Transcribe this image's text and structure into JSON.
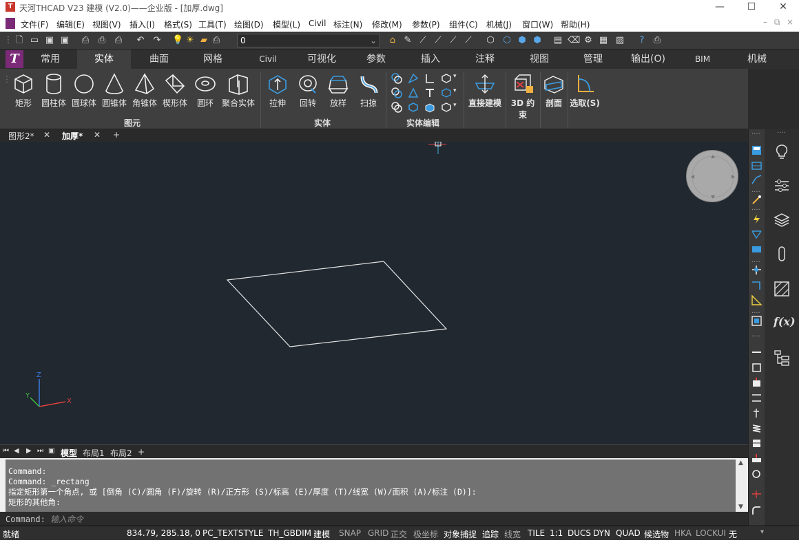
{
  "window": {
    "title": "天河THCAD V23 建模 (V2.0)——企业版 - [加厚.dwg]",
    "app_icon_letter": "T",
    "minimize": "—",
    "maximize": "☐",
    "close": "✕"
  },
  "menu": [
    "文件(F)",
    "编辑(E)",
    "视图(V)",
    "插入(I)",
    "格式(S)",
    "工具(T)",
    "绘图(D)",
    "模型(L)",
    "Civil",
    "标注(N)",
    "修改(M)",
    "参数(P)",
    "组件(C)",
    "机械(J)",
    "窗口(W)",
    "帮助(H)"
  ],
  "layer": {
    "current": "0"
  },
  "ribbon_tabs": [
    "常用",
    "实体",
    "曲面",
    "网格",
    "Civil",
    "可视化",
    "参数",
    "插入",
    "注释",
    "视图",
    "管理",
    "输出(O)",
    "BIM",
    "机械"
  ],
  "ribbon_active_tab": "实体",
  "ribbon": {
    "primitives": {
      "group": "图元",
      "buttons": [
        "矩形",
        "圆柱体",
        "圆球体",
        "圆锥体",
        "角锥体",
        "楔形体",
        "圆环",
        "聚合实体"
      ]
    },
    "solid": {
      "group": "实体",
      "buttons": [
        "拉伸",
        "回转",
        "放样",
        "扫掠"
      ]
    },
    "solid_edit": {
      "group": "实体编辑"
    },
    "direct": {
      "label": "直接建模"
    },
    "constraint": {
      "label": "3D 约束"
    },
    "section": {
      "label": "剖面"
    },
    "select": {
      "label": "选取(S)"
    }
  },
  "doc_tabs": [
    {
      "label": "图形2*"
    },
    {
      "label": "加厚*"
    }
  ],
  "doc_tab_add": "+",
  "layout_tabs": [
    "模型",
    "布局1",
    "布局2"
  ],
  "layout_add": "+",
  "ucs": {
    "x": "X",
    "y": "Y",
    "z": "Z"
  },
  "command_history": [
    "Command:",
    "Command: _rectang",
    "指定矩形第一个角点, 或 [倒角 (C)/圆角 (F)/旋转 (R)/正方形 (S)/标高 (E)/厚度 (T)/线宽 (W)/面积 (A)/标注 (D)]:",
    "矩形的其他角:"
  ],
  "command_prompt": "Command:",
  "command_placeholder": "输入命令",
  "status": {
    "ready": "就绪",
    "coords": "834.79, 285.18, 0",
    "textstyle": "PC_TEXTSTYLE",
    "dimstyle": "TH_GBDIM",
    "workspace": "建模",
    "toggles": [
      {
        "label": "SNAP",
        "on": false
      },
      {
        "label": "GRID",
        "on": false
      },
      {
        "label": "正交",
        "on": false
      },
      {
        "label": "极坐标",
        "on": false
      },
      {
        "label": "对象捕捉",
        "on": true
      },
      {
        "label": "追踪",
        "on": true
      },
      {
        "label": "线宽",
        "on": false
      },
      {
        "label": "TILE",
        "on": true
      },
      {
        "label": "1:1",
        "on": true
      },
      {
        "label": "DUCS",
        "on": true
      },
      {
        "label": "DYN",
        "on": true
      },
      {
        "label": "QUAD",
        "on": true
      },
      {
        "label": "候选物",
        "on": true
      },
      {
        "label": "HKA",
        "on": false
      },
      {
        "label": "LOCKUI",
        "on": false
      },
      {
        "label": "无",
        "on": true
      }
    ]
  },
  "colors": {
    "canvas": "#212830",
    "accent_blue": "#3a9be0",
    "logo_purple": "#7b2a78"
  }
}
